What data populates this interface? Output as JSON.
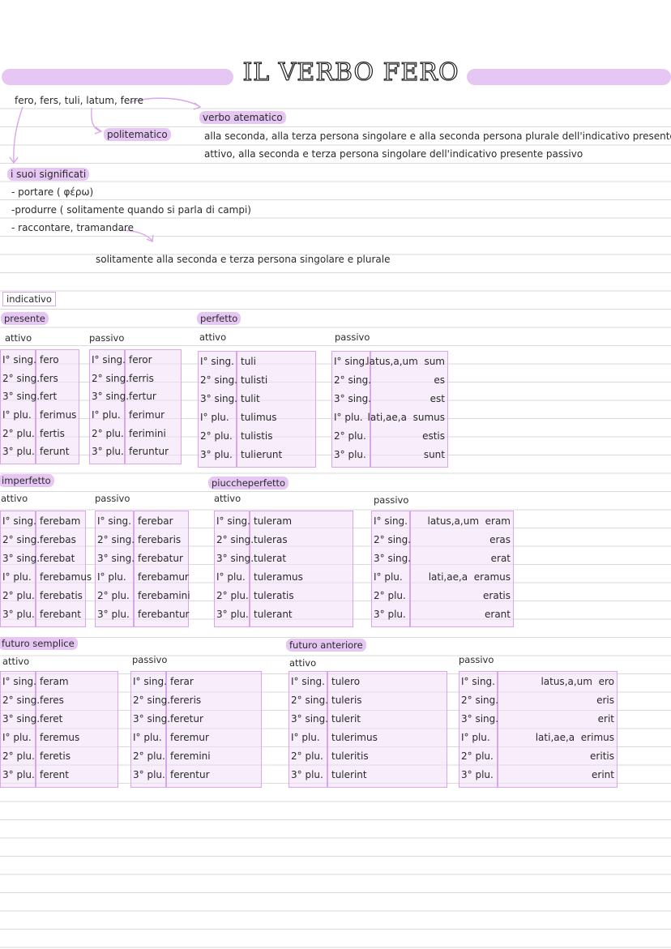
{
  "title": "IL VERBO FERO",
  "intro": {
    "forms": "fero, fers, tuli, latum, ferre",
    "atematico_label": "verbo atematico",
    "politematico_label": "politematico",
    "atematico_note_1": "alla seconda, alla terza persona singolare e alla seconda persona plurale dell'indicativo presente",
    "atematico_note_2": "attivo, alla seconda e terza persona singolare dell'indicativo presente passivo",
    "meanings_label": "i suoi significati",
    "meaning_1": "- portare ( φέρω)",
    "meaning_2": "-produrre ( solitamente quando si parla di campi)",
    "meaning_3": "- raccontare, tramandare",
    "meaning_3_note": "solitamente alla seconda e terza persona singolare e plurale"
  },
  "mood": "indicativo",
  "labels": {
    "attivo": "attivo",
    "passivo": "passivo"
  },
  "persons": [
    "I° sing.",
    "2° sing.",
    "3° sing.",
    "I° plu.",
    "2° plu.",
    "3° plu."
  ],
  "tenses": {
    "presente": {
      "name": "presente",
      "attivo": [
        "fero",
        "fers",
        "fert",
        "ferimus",
        "fertis",
        "ferunt"
      ],
      "passivo": [
        "feror",
        "ferris",
        "fertur",
        "ferimur",
        "ferimini",
        "feruntur"
      ]
    },
    "perfetto": {
      "name": "perfetto",
      "attivo": [
        "tuli",
        "tulisti",
        "tulit",
        "tulimus",
        "tulistis",
        "tulierunt"
      ],
      "passivo": [
        "latus,a,um  sum",
        "es",
        "est",
        "lati,ae,a  sumus",
        "estis",
        "sunt"
      ]
    },
    "imperfetto": {
      "name": "imperfetto",
      "attivo": [
        "ferebam",
        "ferebas",
        "ferebat",
        "ferebamus",
        "ferebatis",
        "ferebant"
      ],
      "passivo": [
        "ferebar",
        "ferebaris",
        "ferebatur",
        "ferebamur",
        "ferebamini",
        "ferebantur"
      ]
    },
    "piuccheperfetto": {
      "name": "piuccheperfetto",
      "attivo": [
        "tuleram",
        "tuleras",
        "tulerat",
        "tuleramus",
        "tuleratis",
        "tulerant"
      ],
      "passivo": [
        "latus,a,um  eram",
        "eras",
        "erat",
        "lati,ae,a  eramus",
        "eratis",
        "erant"
      ]
    },
    "futuro_semplice": {
      "name": "futuro semplice",
      "attivo": [
        "feram",
        "feres",
        "feret",
        "feremus",
        "feretis",
        "ferent"
      ],
      "passivo": [
        "ferar",
        "fereris",
        "feretur",
        "feremur",
        "feremini",
        "ferentur"
      ]
    },
    "futuro_anteriore": {
      "name": "futuro anteriore",
      "attivo": [
        "tulero",
        "tuleris",
        "tulerit",
        "tulerimus",
        "tuleritis",
        "tulerint"
      ],
      "passivo": [
        "latus,a,um  ero",
        "eris",
        "erit",
        "lati,ae,a  erimus",
        "eritis",
        "erint"
      ]
    }
  },
  "colors": {
    "accent": "#e6c6f3",
    "border": "#d9a6ec",
    "fill": "#f0def8",
    "ink": "#2a2a2a",
    "rule": "#dadada"
  }
}
